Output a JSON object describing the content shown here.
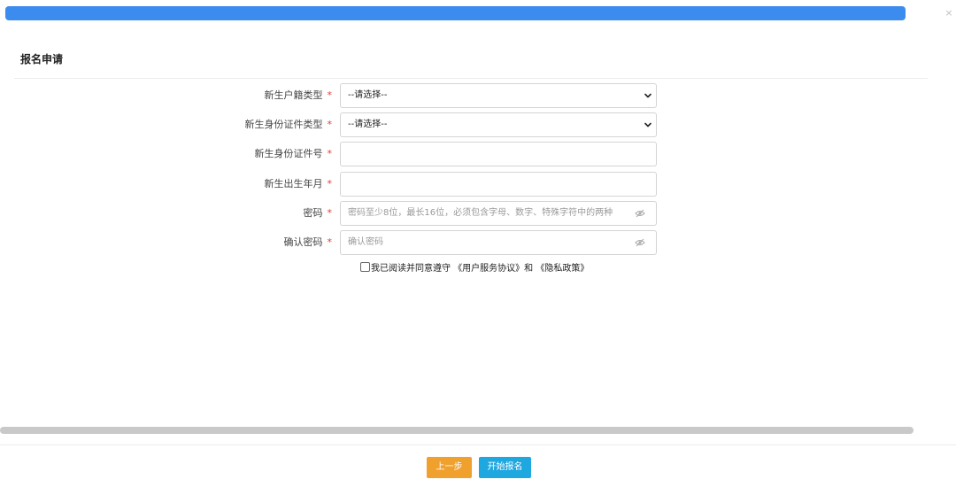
{
  "window": {
    "close_symbol": "×"
  },
  "section": {
    "title": "报名申请"
  },
  "form": {
    "fields": [
      {
        "label": "新生户籍类型",
        "type": "select",
        "value": "--请选择--"
      },
      {
        "label": "新生身份证件类型",
        "type": "select",
        "value": "--请选择--"
      },
      {
        "label": "新生身份证件号",
        "type": "text",
        "value": ""
      },
      {
        "label": "新生出生年月",
        "type": "text",
        "value": ""
      },
      {
        "label": "密码",
        "type": "password",
        "placeholder": "密码至少8位，最长16位，必须包含字母、数字、特殊字符中的两种"
      },
      {
        "label": "确认密码",
        "type": "password",
        "placeholder": "确认密码"
      }
    ],
    "required_mark": "*",
    "agreement_text": "我已阅读并同意遵守 《用户服务协议》和 《隐私政策》"
  },
  "buttons": {
    "prev": "上一步",
    "start": "开始报名"
  },
  "colors": {
    "top_bar": "#3c8cf0",
    "required": "#e53935",
    "prev_button": "#f0a02d",
    "start_button": "#1fa7e0"
  },
  "icons": {
    "select_arrow": "chevron-down-icon",
    "password_toggle": "eye-slash-icon"
  }
}
